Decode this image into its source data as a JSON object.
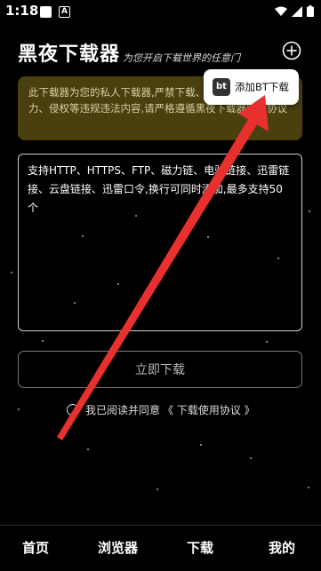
{
  "status_bar": {
    "time": "1:18",
    "notification_icon": "A"
  },
  "header": {
    "title": "黑夜下载器",
    "subtitle": "为您开启下载世界的任意门",
    "add_icon": "plus-circle-icon"
  },
  "notice": {
    "text": "此下载器为您的私人下载器,严禁下载、传播涉及色情、暴力、侵权等违规违法内容,请严格遵循黑夜下载器服务协议"
  },
  "popup": {
    "badge": "bt",
    "label": "添加BT下载"
  },
  "url_input": {
    "placeholder": "支持HTTP、HTTPS、FTP、磁力链、电驴链接、迅雷链接、云盘链接、迅雷口令,换行可同时添加,最多支持50个"
  },
  "download_button": {
    "label": "立即下载"
  },
  "agreement": {
    "prefix": "我已阅读并同意",
    "link": "《 下载使用协议 》"
  },
  "bottom_nav": {
    "items": [
      {
        "label": "首页"
      },
      {
        "label": "浏览器"
      },
      {
        "label": "下载"
      },
      {
        "label": "我的"
      }
    ]
  },
  "colors": {
    "background": "#000000",
    "notice_bg": "#4a3f0f",
    "arrow": "#e8312f"
  }
}
